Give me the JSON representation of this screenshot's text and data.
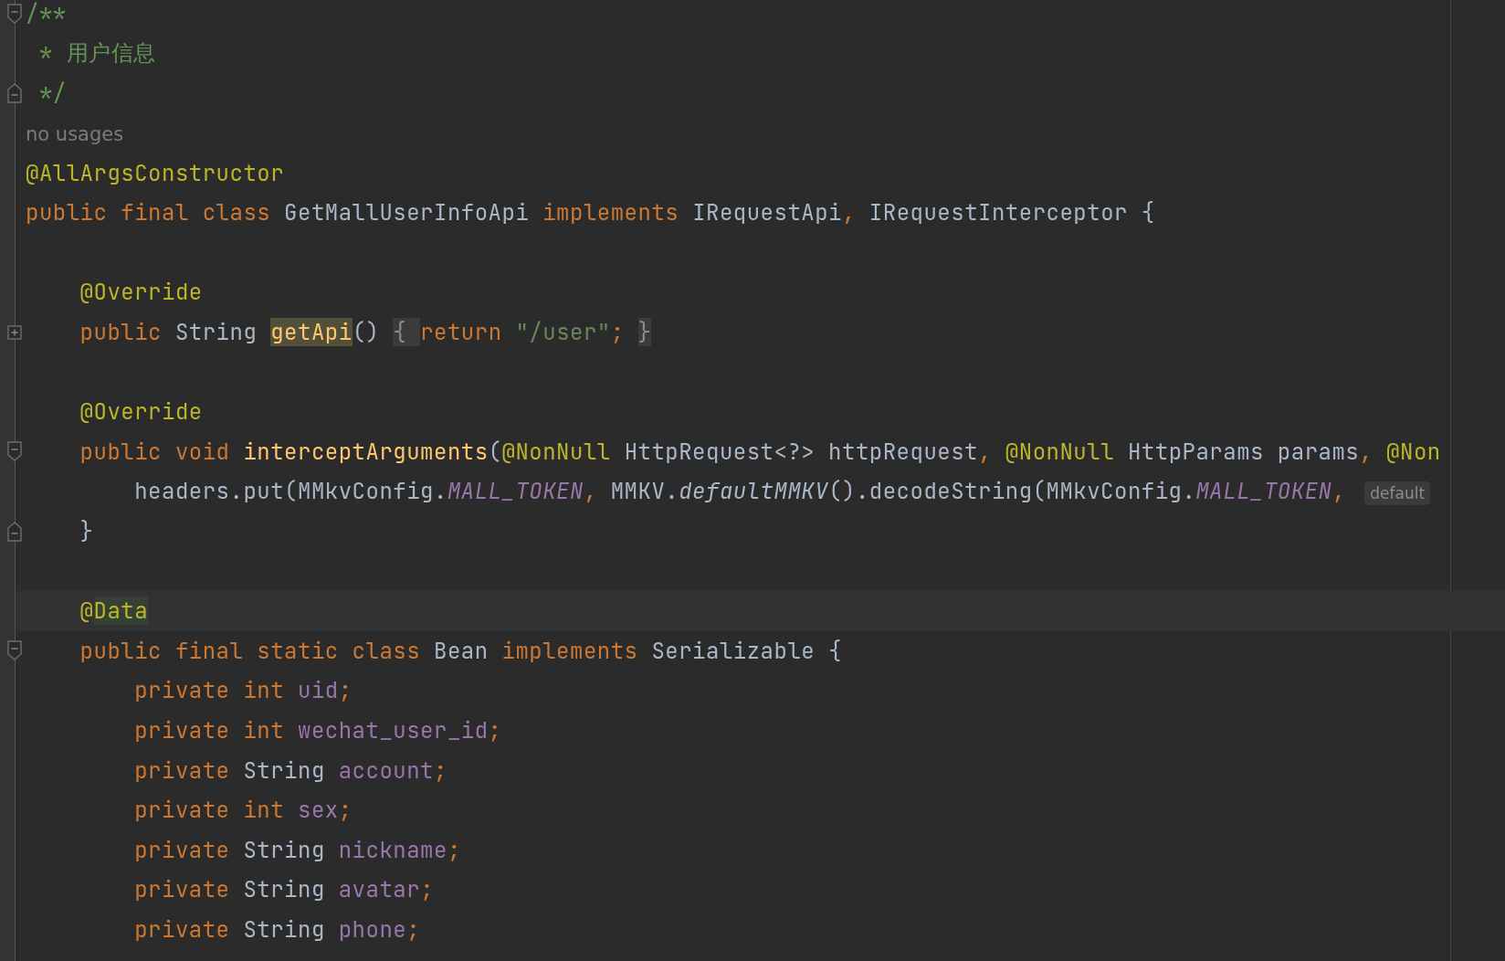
{
  "editor": {
    "lines": [
      {
        "kind": "code",
        "marker": {
          "kind": "fold-start"
        },
        "current": false,
        "tokens": [
          {
            "t": "/**",
            "kind": "doc"
          }
        ]
      },
      {
        "kind": "code",
        "current": false,
        "tokens": [
          {
            "t": " * 用户信息",
            "kind": "doc"
          }
        ]
      },
      {
        "kind": "code",
        "marker": {
          "kind": "fold-end"
        },
        "current": false,
        "tokens": [
          {
            "t": " */",
            "kind": "doc"
          }
        ]
      },
      {
        "kind": "usages",
        "current": false,
        "tokens": [
          {
            "t": "no usages",
            "kind": "hint"
          }
        ]
      },
      {
        "kind": "code",
        "current": false,
        "tokens": [
          {
            "t": "@AllArgsConstructor",
            "kind": "ann"
          }
        ]
      },
      {
        "kind": "code",
        "current": false,
        "tokens": [
          {
            "t": "public final class ",
            "kind": "kw"
          },
          {
            "t": "GetMallUserInfoApi ",
            "kind": "plain"
          },
          {
            "t": "implements ",
            "kind": "kw"
          },
          {
            "t": "IRequestApi",
            "kind": "plain"
          },
          {
            "t": ", ",
            "kind": "kw"
          },
          {
            "t": "IRequestInterceptor {",
            "kind": "plain"
          }
        ]
      },
      {
        "kind": "blank",
        "current": false
      },
      {
        "kind": "code",
        "current": false,
        "tokens": [
          {
            "t": "    @Override",
            "kind": "ann"
          }
        ]
      },
      {
        "kind": "code",
        "marker": {
          "kind": "collapsed"
        },
        "current": false,
        "tokens": [
          {
            "t": "    public ",
            "kind": "kw"
          },
          {
            "t": "String ",
            "kind": "plain"
          },
          {
            "t": "getApi",
            "kind": "match"
          },
          {
            "t": "() ",
            "kind": "plain"
          },
          {
            "t": "{ ",
            "kind": "folded"
          },
          {
            "t": "return ",
            "kind": "kw"
          },
          {
            "t": "\"/user\"",
            "kind": "str"
          },
          {
            "t": "; ",
            "kind": "kw"
          },
          {
            "t": "}",
            "kind": "folded"
          }
        ]
      },
      {
        "kind": "blank",
        "current": false
      },
      {
        "kind": "code",
        "current": false,
        "tokens": [
          {
            "t": "    @Override",
            "kind": "ann"
          }
        ]
      },
      {
        "kind": "code",
        "marker": {
          "kind": "fold-start"
        },
        "current": false,
        "tokens": [
          {
            "t": "    public void ",
            "kind": "kw"
          },
          {
            "t": "interceptArguments",
            "kind": "decl"
          },
          {
            "t": "(",
            "kind": "plain"
          },
          {
            "t": "@NonNull ",
            "kind": "ann"
          },
          {
            "t": "HttpRequest<?> httpRequest",
            "kind": "plain"
          },
          {
            "t": ", ",
            "kind": "kw"
          },
          {
            "t": "@NonNull ",
            "kind": "ann"
          },
          {
            "t": "HttpParams params",
            "kind": "plain"
          },
          {
            "t": ", ",
            "kind": "kw"
          },
          {
            "t": "@Non",
            "kind": "ann"
          }
        ]
      },
      {
        "kind": "code",
        "current": false,
        "tokens": [
          {
            "t": "        headers.put(MMkvConfig.",
            "kind": "plain"
          },
          {
            "t": "MALL_TOKEN",
            "kind": "const"
          },
          {
            "t": ", ",
            "kind": "kw"
          },
          {
            "t": "MMKV.",
            "kind": "plain"
          },
          {
            "t": "defaultMMKV",
            "kind": "static"
          },
          {
            "t": "().decodeString(MMkvConfig.",
            "kind": "plain"
          },
          {
            "t": "MALL_TOKEN",
            "kind": "const"
          },
          {
            "t": ", ",
            "kind": "kw"
          },
          {
            "t": "default",
            "kind": "inlay"
          }
        ]
      },
      {
        "kind": "code",
        "marker": {
          "kind": "fold-end"
        },
        "current": false,
        "tokens": [
          {
            "t": "    }",
            "kind": "plain"
          }
        ]
      },
      {
        "kind": "blank",
        "current": false
      },
      {
        "kind": "code",
        "current": true,
        "tokens": [
          {
            "t": "    @",
            "kind": "ann"
          },
          {
            "t": "Data",
            "kind": "annmark"
          }
        ]
      },
      {
        "kind": "code",
        "marker": {
          "kind": "fold-start"
        },
        "current": false,
        "tokens": [
          {
            "t": "    public final static class ",
            "kind": "kw"
          },
          {
            "t": "Bean ",
            "kind": "plain"
          },
          {
            "t": "implements ",
            "kind": "kw"
          },
          {
            "t": "Serializable {",
            "kind": "plain"
          }
        ]
      },
      {
        "kind": "code",
        "current": false,
        "tokens": [
          {
            "t": "        private int ",
            "kind": "kw"
          },
          {
            "t": "uid",
            "kind": "field"
          },
          {
            "t": ";",
            "kind": "kw"
          }
        ]
      },
      {
        "kind": "code",
        "current": false,
        "tokens": [
          {
            "t": "        private int ",
            "kind": "kw"
          },
          {
            "t": "wechat_user_id",
            "kind": "field"
          },
          {
            "t": ";",
            "kind": "kw"
          }
        ]
      },
      {
        "kind": "code",
        "current": false,
        "tokens": [
          {
            "t": "        private ",
            "kind": "kw"
          },
          {
            "t": "String ",
            "kind": "plain"
          },
          {
            "t": "account",
            "kind": "field"
          },
          {
            "t": ";",
            "kind": "kw"
          }
        ]
      },
      {
        "kind": "code",
        "current": false,
        "tokens": [
          {
            "t": "        private int ",
            "kind": "kw"
          },
          {
            "t": "sex",
            "kind": "field"
          },
          {
            "t": ";",
            "kind": "kw"
          }
        ]
      },
      {
        "kind": "code",
        "current": false,
        "tokens": [
          {
            "t": "        private ",
            "kind": "kw"
          },
          {
            "t": "String ",
            "kind": "plain"
          },
          {
            "t": "nickname",
            "kind": "field"
          },
          {
            "t": ";",
            "kind": "kw"
          }
        ]
      },
      {
        "kind": "code",
        "current": false,
        "tokens": [
          {
            "t": "        private ",
            "kind": "kw"
          },
          {
            "t": "String ",
            "kind": "plain"
          },
          {
            "t": "avatar",
            "kind": "field"
          },
          {
            "t": ";",
            "kind": "kw"
          }
        ]
      },
      {
        "kind": "code",
        "current": false,
        "tokens": [
          {
            "t": "        private ",
            "kind": "kw"
          },
          {
            "t": "String ",
            "kind": "plain"
          },
          {
            "t": "phone",
            "kind": "field"
          },
          {
            "t": ";",
            "kind": "kw"
          }
        ]
      }
    ]
  }
}
